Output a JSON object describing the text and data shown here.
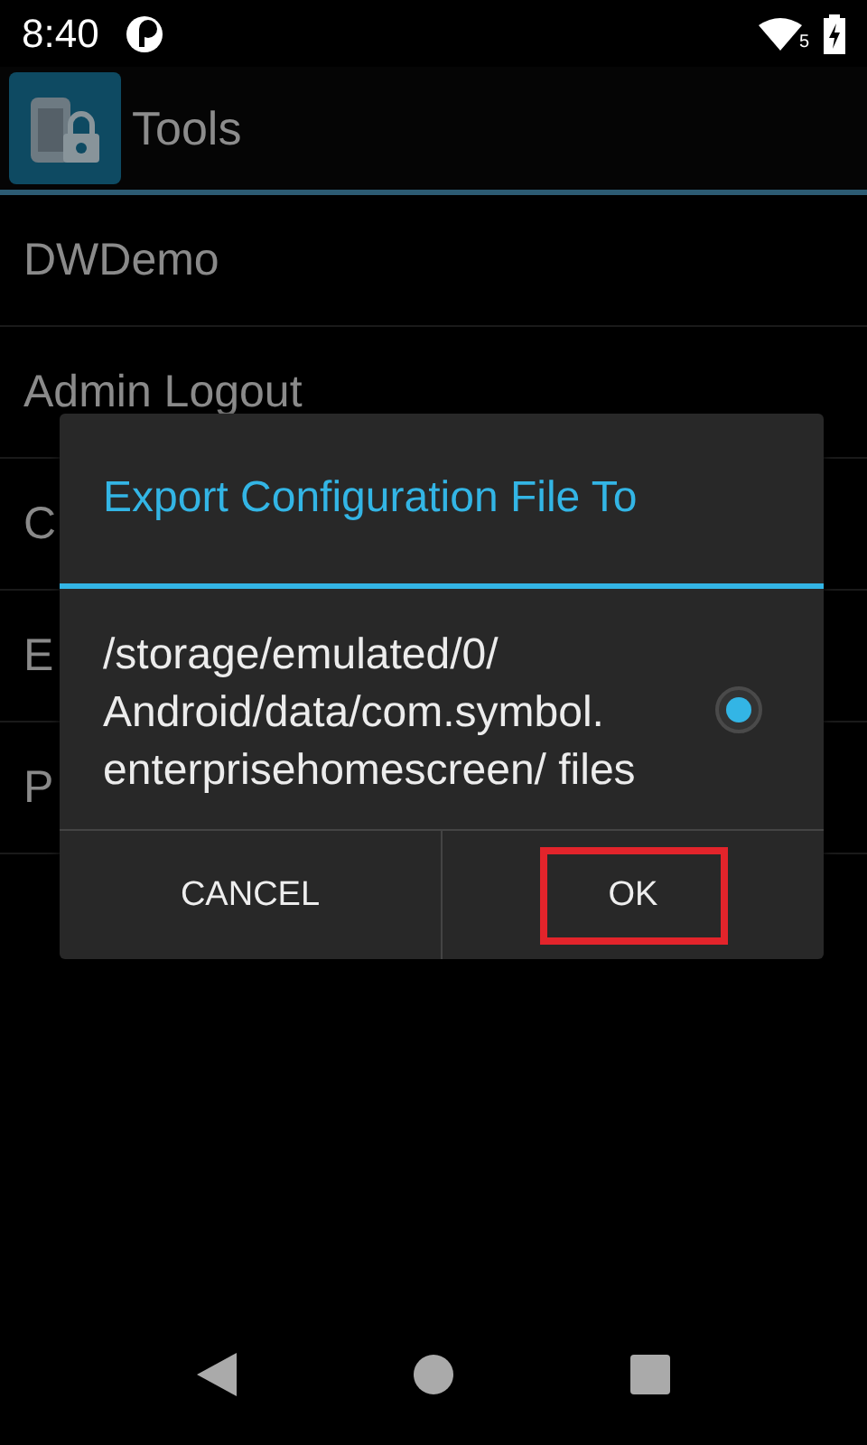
{
  "status_bar": {
    "time": "8:40",
    "wifi_badge": "5"
  },
  "action_bar": {
    "title": "Tools"
  },
  "list": [
    {
      "label": "DWDemo"
    },
    {
      "label": "Admin Logout"
    },
    {
      "label": "C"
    },
    {
      "label": "E"
    },
    {
      "label": "P"
    }
  ],
  "dialog": {
    "title": "Export Configuration File To",
    "options": [
      {
        "label": "/storage/emulated/0/ Android/data/com.symbol. enterprisehomescreen/ files",
        "selected": true
      }
    ],
    "buttons": [
      {
        "label": "CANCEL",
        "highlighted": false
      },
      {
        "label": "OK",
        "highlighted": true
      }
    ]
  }
}
